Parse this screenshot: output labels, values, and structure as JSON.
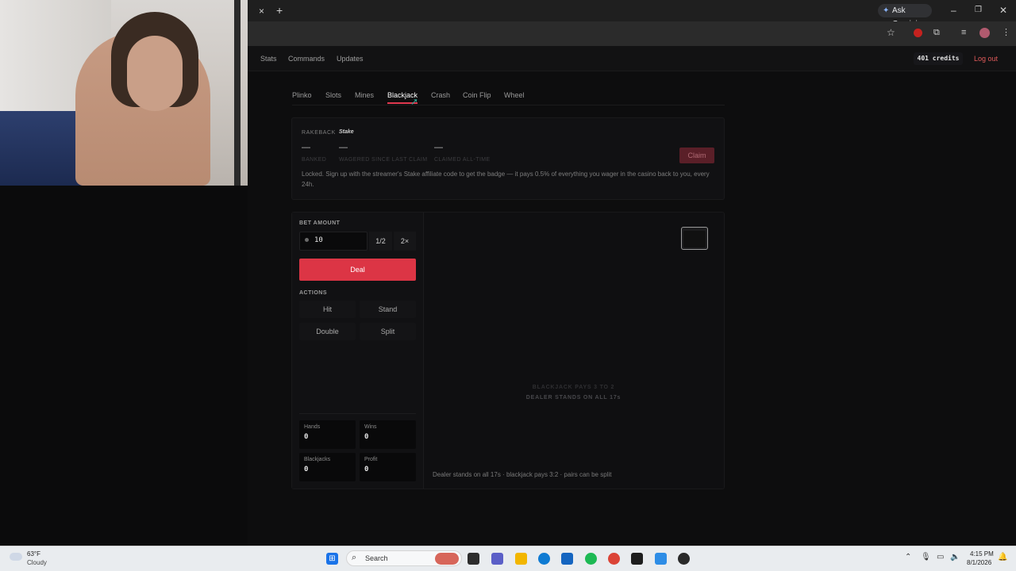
{
  "browser": {
    "ask_gemini": "Ask Gemini",
    "close_tab": "×",
    "new_tab": "+",
    "window_minimize": "–",
    "window_restore": "❐",
    "window_close": "✕"
  },
  "topnav": {
    "links": [
      "Stats",
      "Commands",
      "Updates"
    ],
    "credits": "401 credits",
    "logout": "Log out"
  },
  "game_tabs": [
    "Plinko",
    "Slots",
    "Mines",
    "Blackjack",
    "Crash",
    "Coin Flip",
    "Wheel"
  ],
  "active_tab": "Blackjack",
  "rakeback": {
    "title": "RAKEBACK",
    "badge": "Stake",
    "banked_value": "—",
    "banked_label": "BANKED",
    "wagered_value": "—",
    "wagered_label": "WAGERED SINCE LAST CLAIM",
    "claimed_value": "—",
    "claimed_label": "CLAIMED ALL-TIME",
    "claim_button": "Claim",
    "description": "Locked. Sign up with the streamer's Stake affiliate code to get the badge — it pays 0.5% of everything you wager in the casino back to you, every 24h."
  },
  "bet": {
    "label": "BET AMOUNT",
    "value": "10",
    "half": "1/2",
    "double": "2×",
    "deal": "Deal"
  },
  "actions": {
    "label": "ACTIONS",
    "hit": "Hit",
    "stand": "Stand",
    "double": "Double",
    "split": "Split"
  },
  "stats": {
    "hands_label": "Hands",
    "hands": "0",
    "wins_label": "Wins",
    "wins": "0",
    "blackjacks_label": "Blackjacks",
    "blackjacks": "0",
    "profit_label": "Profit",
    "profit": "0"
  },
  "table": {
    "line1": "BLACKJACK PAYS 3 TO 2",
    "line2": "DEALER STANDS ON ALL 17s",
    "footer": "Dealer stands on all 17s · blackjack pays 3:2 · pairs can be split"
  },
  "taskbar": {
    "temp": "63°F",
    "weather": "Cloudy",
    "search": "Search",
    "time": "4:15 PM",
    "date": "8/1/2026"
  },
  "colors": {
    "accent": "#dc3545",
    "logout": "#e05a5a",
    "background": "#0d0d0e"
  }
}
